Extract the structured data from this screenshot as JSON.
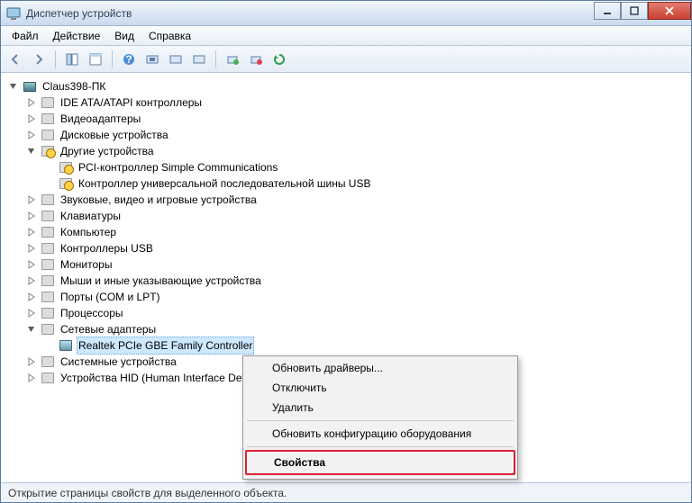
{
  "window": {
    "title": "Диспетчер устройств"
  },
  "menus": {
    "file": "Файл",
    "action": "Действие",
    "view": "Вид",
    "help": "Справка"
  },
  "tree": {
    "root": "Claus398-ПК",
    "items": [
      {
        "label": "IDE ATA/ATAPI контроллеры",
        "expand": "closed"
      },
      {
        "label": "Видеоадаптеры",
        "expand": "closed"
      },
      {
        "label": "Дисковые устройства",
        "expand": "closed"
      },
      {
        "label": "Другие устройства",
        "expand": "open",
        "warn": true,
        "children": [
          {
            "label": "PCI-контроллер Simple Communications",
            "warn": true
          },
          {
            "label": "Контроллер универсальной последовательной шины USB",
            "warn": true
          }
        ]
      },
      {
        "label": "Звуковые, видео и игровые устройства",
        "expand": "closed"
      },
      {
        "label": "Клавиатуры",
        "expand": "closed"
      },
      {
        "label": "Компьютер",
        "expand": "closed"
      },
      {
        "label": "Контроллеры USB",
        "expand": "closed"
      },
      {
        "label": "Мониторы",
        "expand": "closed"
      },
      {
        "label": "Мыши и иные указывающие устройства",
        "expand": "closed"
      },
      {
        "label": "Порты (COM и LPT)",
        "expand": "closed"
      },
      {
        "label": "Процессоры",
        "expand": "closed"
      },
      {
        "label": "Сетевые адаптеры",
        "expand": "open",
        "children": [
          {
            "label": "Realtek PCIe GBE Family Controller",
            "selected": true
          }
        ]
      },
      {
        "label": "Системные устройства",
        "expand": "closed"
      },
      {
        "label": "Устройства HID (Human Interface Devices)",
        "expand": "closed",
        "hid": true
      }
    ]
  },
  "context_menu": {
    "update_drivers": "Обновить драйверы...",
    "disable": "Отключить",
    "delete": "Удалить",
    "scan_hw": "Обновить конфигурацию оборудования",
    "properties": "Свойства"
  },
  "statusbar": {
    "text": "Открытие страницы свойств для выделенного объекта."
  }
}
